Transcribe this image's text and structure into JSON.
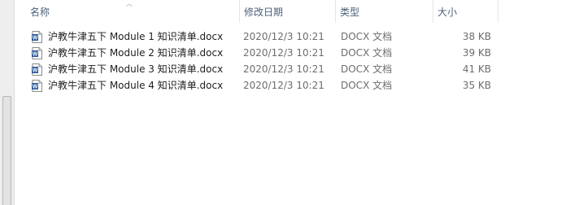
{
  "columns": {
    "name": "名称",
    "modified": "修改日期",
    "type": "类型",
    "size": "大小"
  },
  "files": [
    {
      "name": "沪教牛津五下 Module 1 知识清单.docx",
      "modified": "2020/12/3 10:21",
      "type": "DOCX 文档",
      "size": "38 KB",
      "icon": "word-document-icon"
    },
    {
      "name": "沪教牛津五下 Module 2 知识清单.docx",
      "modified": "2020/12/3 10:21",
      "type": "DOCX 文档",
      "size": "39 KB",
      "icon": "word-document-icon"
    },
    {
      "name": "沪教牛津五下 Module 3 知识清单.docx",
      "modified": "2020/12/3 10:21",
      "type": "DOCX 文档",
      "size": "41 KB",
      "icon": "word-document-icon"
    },
    {
      "name": "沪教牛津五下 Module 4 知识清单.docx",
      "modified": "2020/12/3 10:21",
      "type": "DOCX 文档",
      "size": "35 KB",
      "icon": "word-document-icon"
    }
  ],
  "colors": {
    "header_text": "#4c607a",
    "icon_blue": "#2b5797"
  }
}
